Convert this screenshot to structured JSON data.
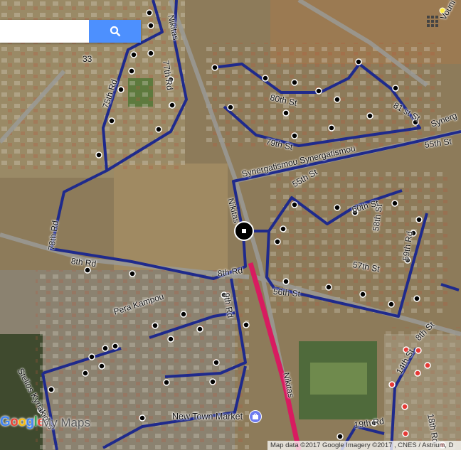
{
  "search": {
    "value": "",
    "placeholder": ""
  },
  "top_left_number": "33",
  "street_labels": {
    "nikitas_top": "Nikitas",
    "seventy_seventh_rd": "77th Rd",
    "seventy_fifth_rd": "75th Rd",
    "eightieth_st": "80th St",
    "eighty_first_st": "81 st St",
    "seventy_ninth_st": "79th St",
    "synergatismou_right": "Synerg",
    "fifty_fifth_st_right": "55th St",
    "synergatismou_main": "Synergatismou  Synergatismou",
    "fifty_fifth_st": "55th St",
    "sixtieth_st": "60th St",
    "fifty_eighth_st": "58th St",
    "fifty_ninth_rd": "59th Rd",
    "fifty_seventh_st": "57th St",
    "fifty_sixth_st": "56th St",
    "seventy_eighth_rd": "78th Rd",
    "nikitas_mid": "Nikitas",
    "eighth_rd_left": "8th Rd",
    "eighth_rd_mid": "8th Rd",
    "pera_kampou": "Pera Kampou",
    "stelios_kyriakides": "Stelios Kyriakides",
    "ninth_rd": "9th Rd",
    "eighth_st": "8th St",
    "fourteenth_st": "14th St",
    "eighteenth_rd": "18th Rd",
    "nineteenth_rd": "19th Rd",
    "nikitas_bottom": "Nikitas",
    "vouni": "Vouni"
  },
  "poi": {
    "name": "New Town Market"
  },
  "logo": {
    "g": "G",
    "o1": "o",
    "o2": "o",
    "g2": "g",
    "l": "l",
    "e": "e",
    "product": "My Maps"
  },
  "attribution": "Map data ©2017 Google Imagery ©2017 , CNES / Astrium, D",
  "colors": {
    "route": "#1f2a8c",
    "highlight": "#d81b60",
    "stop": "#000000",
    "stop_alt": "#e53935",
    "search_button": "#4d90fe"
  },
  "icons": {
    "search": "search-icon",
    "apps": "grid-icon",
    "poi": "shopping-icon"
  }
}
